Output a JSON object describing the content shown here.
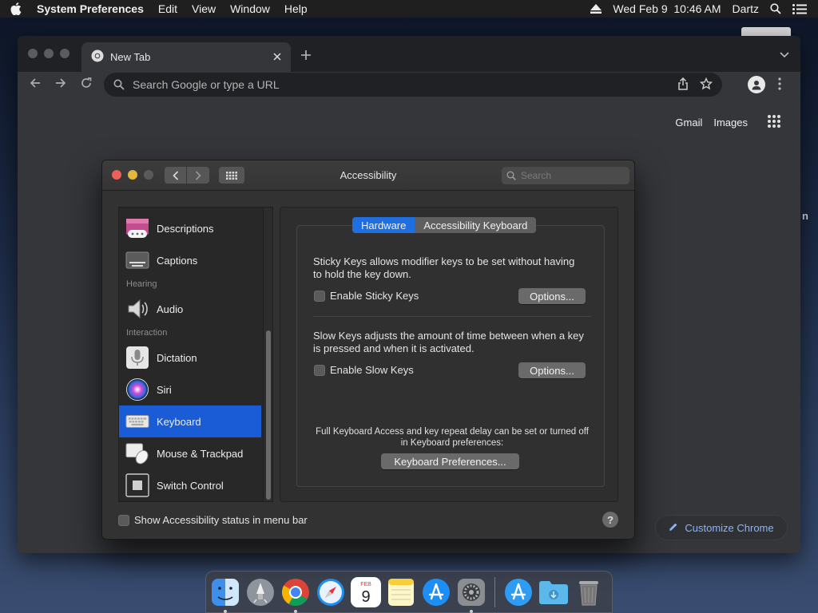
{
  "menubar": {
    "app_name": "System Preferences",
    "menus": [
      "Edit",
      "View",
      "Window",
      "Help"
    ],
    "datetime": "Wed Feb 9  10:46 AM",
    "user": "Dartz"
  },
  "chrome": {
    "tab_title": "New Tab",
    "omnibox_placeholder": "Search Google or type a URL",
    "link_gmail": "Gmail",
    "link_images": "Images",
    "customize_label": "Customize Chrome"
  },
  "prefs": {
    "window_title": "Accessibility",
    "search_placeholder": "Search",
    "sidebar": {
      "items": [
        {
          "label": "Descriptions",
          "icon": "descriptions-icon"
        },
        {
          "label": "Captions",
          "icon": "captions-icon"
        },
        {
          "label": "Audio",
          "icon": "speaker-icon"
        },
        {
          "label": "Dictation",
          "icon": "microphone-icon"
        },
        {
          "label": "Siri",
          "icon": "siri-icon"
        },
        {
          "label": "Keyboard",
          "icon": "keyboard-icon",
          "selected": true
        },
        {
          "label": "Mouse & Trackpad",
          "icon": "mouse-icon"
        },
        {
          "label": "Switch Control",
          "icon": "switch-control-icon"
        }
      ],
      "headings": {
        "hearing": "Hearing",
        "interaction": "Interaction"
      }
    },
    "tabs": {
      "hardware": "Hardware",
      "accessibility_keyboard": "Accessibility Keyboard",
      "active": "Hardware"
    },
    "sticky": {
      "description": "Sticky Keys allows modifier keys to be set without having to hold the key down.",
      "checkbox_label": "Enable Sticky Keys",
      "checked": false,
      "options_label": "Options..."
    },
    "slow": {
      "description": "Slow Keys adjusts the amount of time between when a key is pressed and when it is activated.",
      "checkbox_label": "Enable Slow Keys",
      "checked": false,
      "options_label": "Options..."
    },
    "note": "Full Keyboard Access and key repeat delay can be set or turned off in Keyboard preferences:",
    "keyboard_prefs_button": "Keyboard Preferences...",
    "status_checkbox_label": "Show Accessibility status in menu bar",
    "status_checked": false,
    "help_label": "?"
  },
  "dock": {
    "apps": [
      "finder-icon",
      "launchpad-icon",
      "chrome-icon",
      "safari-icon",
      "calendar-icon",
      "notes-icon",
      "app-store-icon",
      "system-preferences-icon",
      "app-store-icon",
      "downloads-folder-icon",
      "trash-icon"
    ],
    "calendar_month": "FEB",
    "calendar_day": "9"
  },
  "peek_text": "n",
  "colors": {
    "accent": "#1a5cd6",
    "segment_active": "#1f6fe0",
    "link_blue": "#8ab4f8"
  }
}
